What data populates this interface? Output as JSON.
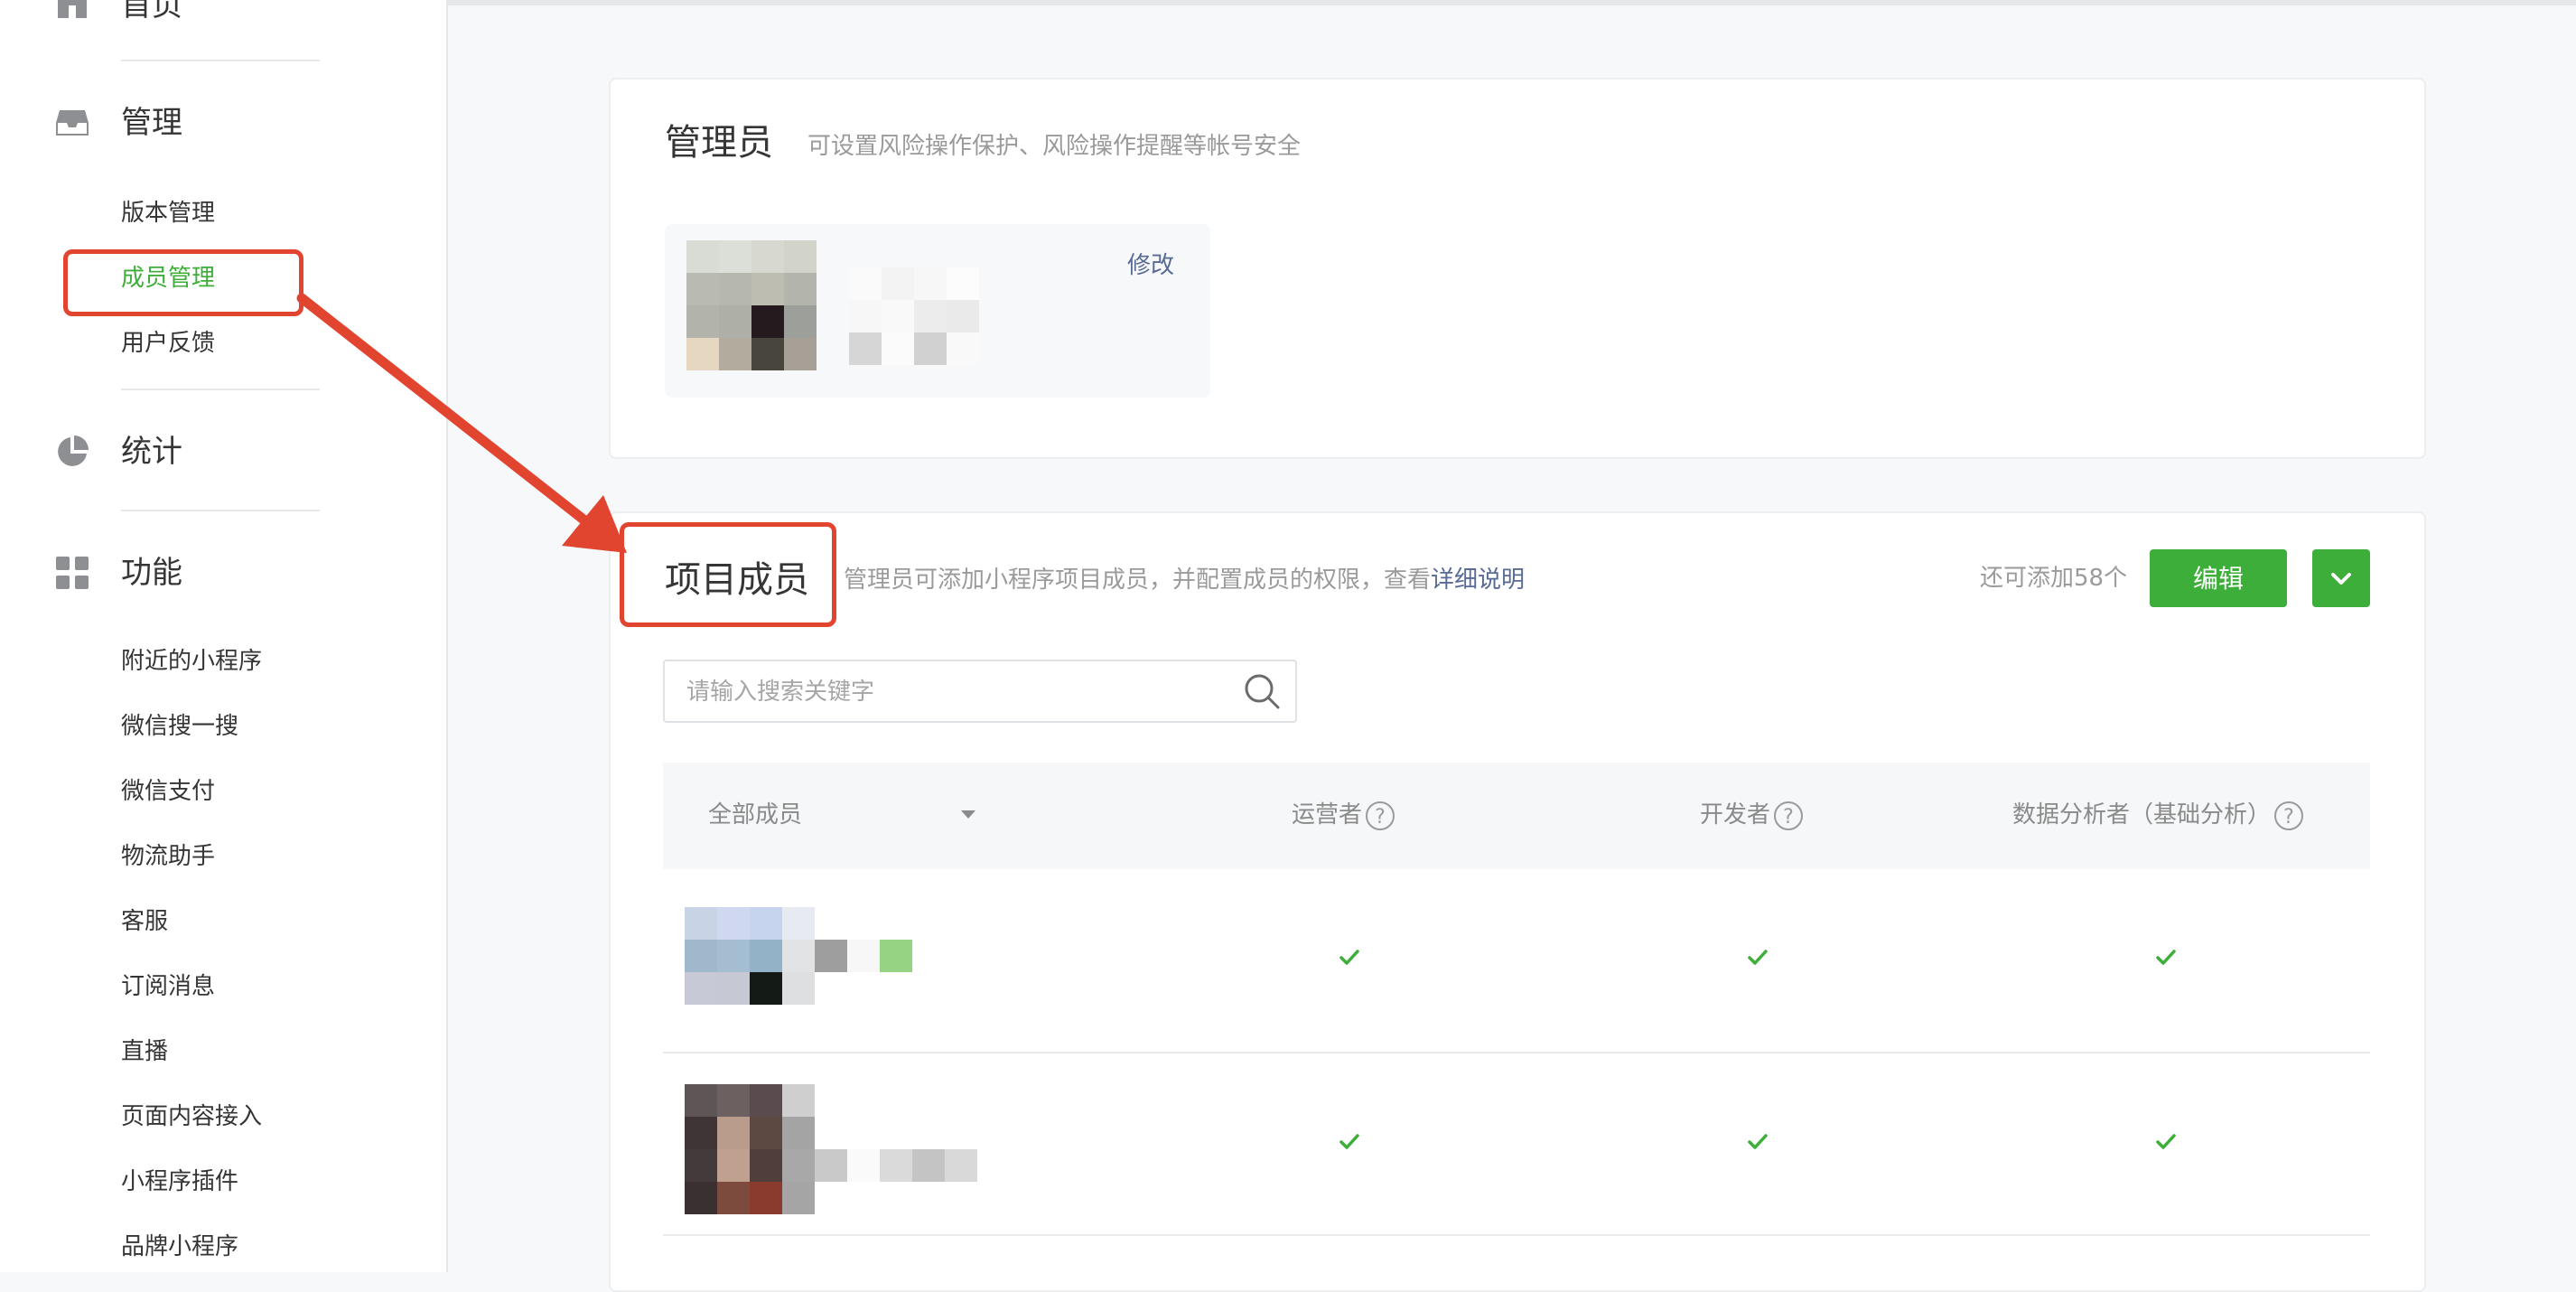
{
  "sidebar": {
    "home_label": "首页",
    "sections": [
      {
        "title": "管理",
        "icon": "inbox-icon",
        "items": [
          "版本管理",
          "成员管理",
          "用户反馈"
        ]
      },
      {
        "title": "统计",
        "icon": "pie-chart-icon",
        "items": []
      },
      {
        "title": "功能",
        "icon": "grid-icon",
        "items": [
          "附近的小程序",
          "微信搜一搜",
          "微信支付",
          "物流助手",
          "客服",
          "订阅消息",
          "直播",
          "页面内容接入",
          "小程序插件",
          "品牌小程序"
        ]
      }
    ],
    "active_item": "成员管理"
  },
  "admin_card": {
    "title": "管理员",
    "description": "可设置风险操作保护、风险操作提醒等帐号安全",
    "modify_label": "修改"
  },
  "members_card": {
    "title": "项目成员",
    "description_prefix": "管理员可添加小程序项目成员，并配置成员的权限，查看",
    "description_link": "详细说明",
    "remaining": "还可添加58个",
    "edit_button": "编辑",
    "search_placeholder": "请输入搜索关键字",
    "columns": {
      "filter": "全部成员",
      "operator": "运营者",
      "developer": "开发者",
      "analyst": "数据分析者（基础分析）"
    },
    "help_glyph": "?",
    "rows": [
      {
        "operator": true,
        "developer": true,
        "analyst": true
      },
      {
        "operator": true,
        "developer": true,
        "analyst": true
      }
    ]
  },
  "colors": {
    "accent_green": "#3eae3a",
    "link_blue": "#576b95",
    "annotation_red": "#e2452f"
  }
}
